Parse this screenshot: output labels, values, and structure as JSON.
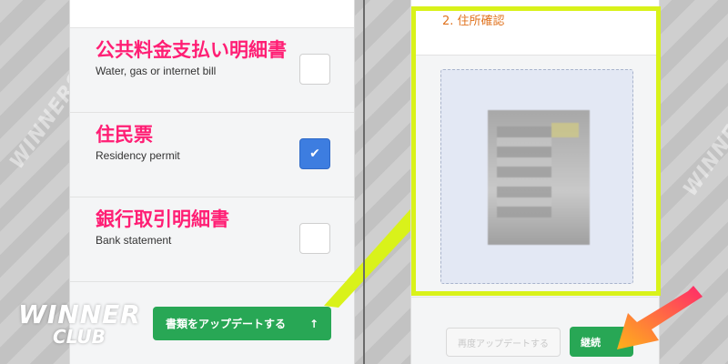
{
  "colors": {
    "highlight": "#d9f21a",
    "accent_pink": "#ff1e74",
    "button_green": "#28a755",
    "checkbox_blue": "#3d7de0",
    "title_orange": "#e0731f"
  },
  "documents": [
    {
      "jp": "公共料金支払い明細書",
      "en": "Water, gas or internet bill",
      "checked": false
    },
    {
      "jp": "住民票",
      "en": "Residency permit",
      "checked": true
    },
    {
      "jp": "銀行取引明細書",
      "en": "Bank statement",
      "checked": false
    }
  ],
  "upload_button": {
    "label": "書類をアップデートする",
    "icon": "arrow-up-icon",
    "glyph": "↑"
  },
  "right": {
    "title": "2. 住所確認",
    "reupload_label": "再度アップデートする",
    "continue_label": "継続"
  },
  "checkmark": "✔",
  "watermark": {
    "line1": "WINNER",
    "line2": "CLUB"
  }
}
